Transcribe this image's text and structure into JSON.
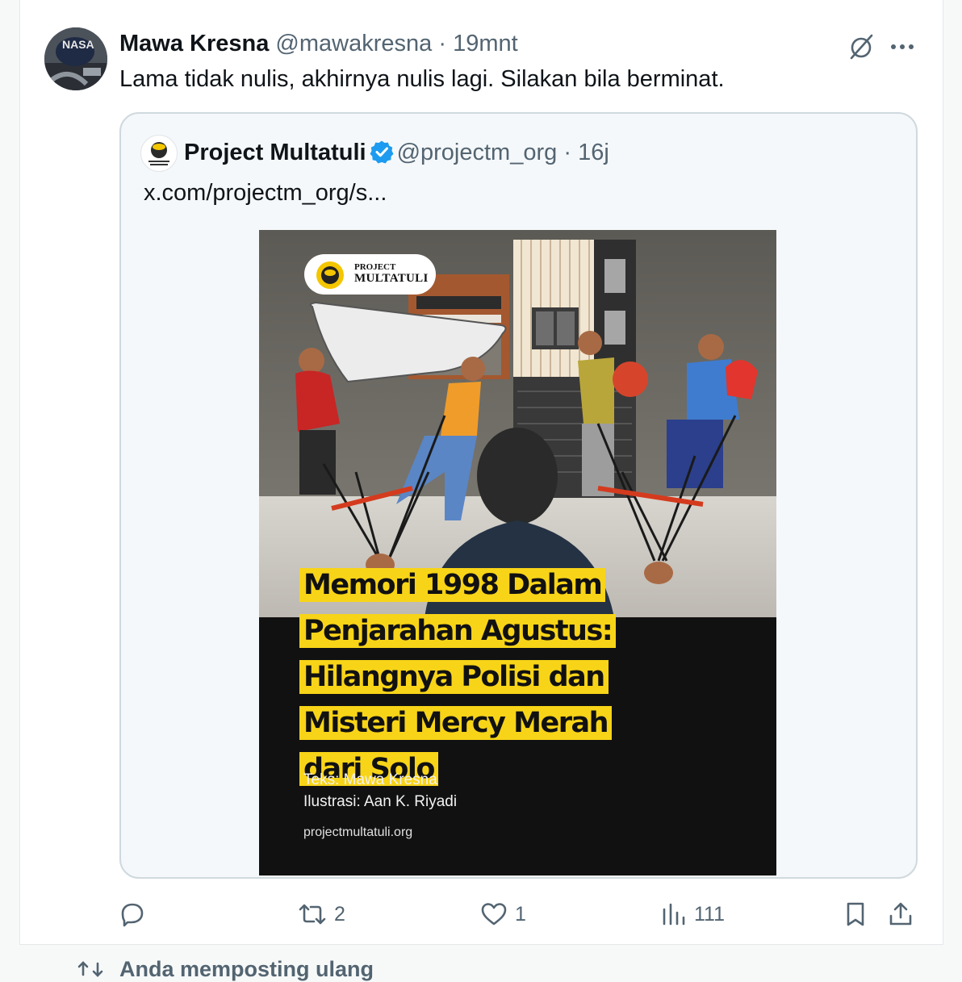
{
  "post": {
    "display_name": "Mawa Kresna",
    "handle": "@mawakresna",
    "separator": "·",
    "time": "19mnt",
    "text": "Lama tidak nulis, akhirnya nulis lagi. Silakan bila berminat."
  },
  "avatar_text": "NASA",
  "quote": {
    "display_name": "Project Multatuli",
    "handle": "@projectm_org",
    "separator": "·",
    "time": "16j",
    "text": "x.com/projectm_org/s..."
  },
  "poster": {
    "logo_line1": "PROJECT",
    "logo_line2": "MULTATULI",
    "title_lines": [
      "Memori 1998 Dalam",
      "Penjarahan Agustus:",
      "Hilangnya Polisi dan",
      "Misteri Mercy Merah",
      "dari Solo"
    ],
    "credit_text": "Teks: Mawa Kresna",
    "credit_illustration": "Ilustrasi: Aan K. Riyadi",
    "site": "projectmultatuli.org"
  },
  "actions": {
    "reposts": "2",
    "likes": "1",
    "views": "111"
  },
  "footer": {
    "text": "Anda memposting ulang"
  },
  "colors": {
    "accent": "#1d9bf0",
    "secondary_text": "#536471",
    "poster_highlight": "#f8d418"
  }
}
